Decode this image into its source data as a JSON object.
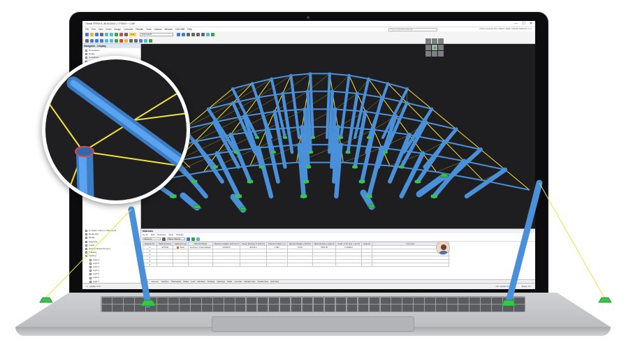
{
  "app": {
    "window_title": "Global RFEM 6 | BUILDING | CTS003 + 1.06*",
    "window_controls": [
      "—",
      "☐",
      "✕"
    ]
  },
  "menu": {
    "items": [
      "File",
      "Edit",
      "View",
      "Insert",
      "Assign",
      "Calculate",
      "Results",
      "Tools",
      "Options",
      "Window",
      "CAD-BIM",
      "Help"
    ],
    "search_placeholder": "Type a keyword (Alt+Q)",
    "online_text": "Online License Pro | Martin Jaglin | Dlubal Software s.r.o."
  },
  "toolbar": {
    "load_case_tag": "LC1",
    "load_case": "Self-weight"
  },
  "navigator": {
    "title": "Navigator - Display",
    "items_top": [
      "Dimensions",
      "Nodes",
      "Guidelines",
      "Building Grids",
      "Visual Objects"
    ],
    "items_bottom": [
      "Consider Colors in Wireframe",
      "Rendering",
      "Model",
      "Supports",
      "Loads",
      "Surface Reinforcement",
      "Shading",
      "Lighting",
      "Light 1",
      "Light 2",
      "Light 3",
      "Light 4",
      "Light 5",
      "Light 6",
      "Light 7",
      "Light 8",
      "Display Light Positions",
      "Preselection"
    ],
    "selected_item": "Display Light Positions"
  },
  "materials_table": {
    "title": "Materials",
    "menu": [
      "Go To",
      "Edit",
      "Selection",
      "View",
      "Settings"
    ],
    "filter_left": "Structure",
    "filter_right": "Basic Objects",
    "headers": [
      "Material No.",
      "Material Name",
      "Material Type",
      "Material Model",
      "Modulus of Elast. E [N/mm²]",
      "Shear Modulus G [N/mm²]",
      "Poisson's Ratio v [-]",
      "Specific Weight γ [kN/m³]",
      "Mass Density ρ [kg/m³]",
      "Coeff. of Th. Exp. α [1/°C]",
      "Options",
      "Comment"
    ],
    "rows": [
      [
        "1",
        "S275JR",
        "Steel",
        "Isotropic | Linear Elastic",
        "210000.0",
        "80769.2",
        "0.300",
        "78.50",
        "7850.00",
        "0.000012",
        "",
        ""
      ],
      [
        "2",
        "",
        "",
        "",
        "",
        "",
        "",
        "",
        "",
        "",
        "",
        ""
      ],
      [
        "3",
        "",
        "",
        "",
        "",
        "",
        "",
        "",
        "",
        "",
        "",
        ""
      ],
      [
        "4",
        "",
        "",
        "",
        "",
        "",
        "",
        "",
        "",
        "",
        "",
        ""
      ],
      [
        "5",
        "",
        "",
        "",
        "",
        "",
        "",
        "",
        "",
        "",
        "",
        ""
      ],
      [
        "6",
        "",
        "",
        "",
        "",
        "",
        "",
        "",
        "",
        "",
        "",
        ""
      ]
    ],
    "pager": "1 of 13",
    "tabs": [
      "Materials",
      "Sections",
      "Thicknesses",
      "Nodes",
      "Lines",
      "Members",
      "Surfaces",
      "Openings",
      "Solids",
      "Line Sets",
      "Member Sets",
      "Surface Sets",
      "Solid Sets"
    ]
  },
  "status": {
    "left": "1 - Global XYZ",
    "cs": "CS: Global XYZ",
    "plane": "Plane: XY"
  },
  "colors": {
    "member": "#4a90d9",
    "cable": "#f2e33c",
    "support": "#39c44a",
    "viewport_bg": "#1e1e21"
  }
}
